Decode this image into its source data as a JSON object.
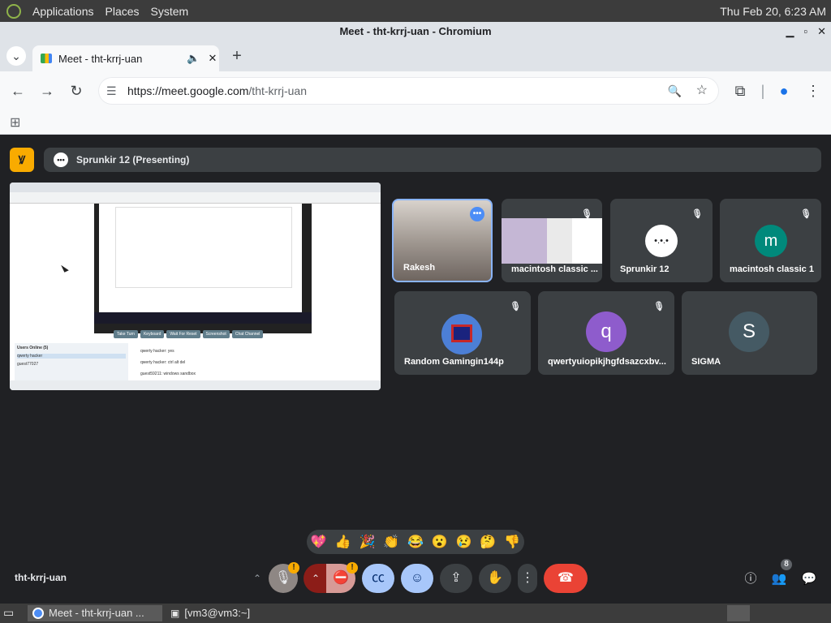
{
  "top_panel": {
    "menus": [
      "Applications",
      "Places",
      "System"
    ],
    "clock": "Thu Feb 20,  6:23 AM"
  },
  "window": {
    "title": "Meet - tht-krrj-uan - Chromium"
  },
  "tab": {
    "title": "Meet - tht-krrj-uan"
  },
  "address_bar": {
    "url_host": "https://meet.google.com",
    "url_path": "/tht-krrj-uan"
  },
  "meet": {
    "presenting_label": "Sprunkir 12 (Presenting)",
    "shared_screen": {
      "buttons": [
        "Take Turn",
        "Keyboard",
        "Wait For Reset",
        "Screenshot",
        "Chat Channel"
      ],
      "users_title": "Users Online (5)",
      "users": [
        "qwerty hacker",
        "guest77027"
      ],
      "chat_lines": [
        "qwerty hacker: yes",
        "qwerty hacker: ctrl alt del",
        "guest59211: windows sandbox"
      ]
    },
    "participants": [
      {
        "name": "Rakesh",
        "initial": "",
        "color": "",
        "muted": false,
        "active": true
      },
      {
        "name": "macintosh classic ...",
        "initial": "",
        "color": "",
        "muted": true,
        "active": false
      },
      {
        "name": "Sprunkir 12",
        "initial": "",
        "color": "#ffffff",
        "muted": true,
        "active": false
      },
      {
        "name": "macintosh classic 1",
        "initial": "m",
        "color": "#00897b",
        "muted": true,
        "active": false
      },
      {
        "name": "Random Gamingin144p",
        "initial": "",
        "color": "#4c7fd6",
        "muted": true,
        "active": false
      },
      {
        "name": "qwertyuiopikjhgfdsazcxbv...",
        "initial": "q",
        "color": "#8e5ccc",
        "muted": true,
        "active": false
      },
      {
        "name": "SIGMA",
        "initial": "S",
        "color": "#455a64",
        "muted": false,
        "active": false
      }
    ],
    "reactions": [
      "💖",
      "👍",
      "🎉",
      "👏",
      "😂",
      "😮",
      "😢",
      "🤔",
      "👎"
    ],
    "meeting_code": "tht-krrj-uan",
    "people_count": "8",
    "colors": {
      "end_call": "#ea4335",
      "muted_ctl": "#8c1d18",
      "active_ctl": "#a8c7fa",
      "warn": "#f9ab00"
    }
  },
  "os_taskbar": {
    "tasks": [
      "Meet - tht-krrj-uan ...",
      "[vm3@vm3:~]"
    ]
  }
}
